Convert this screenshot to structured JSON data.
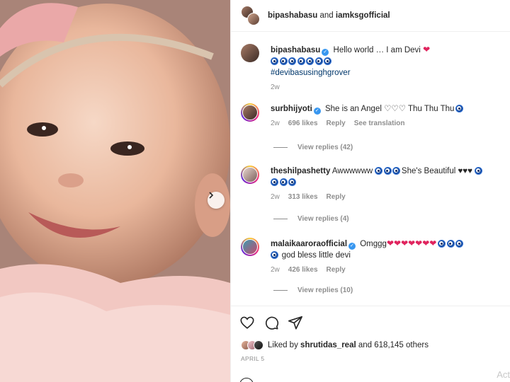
{
  "post": {
    "header": {
      "user1": "bipashabasu",
      "joiner": "and",
      "user2": "iamksgofficial"
    },
    "caption": {
      "username": "bipashabasu",
      "text": "Hello world … I am Devi",
      "hashtag": "#devibasusinghgrover",
      "time": "2w",
      "eye_count": 7
    },
    "comments": [
      {
        "username": "surbhijyoti",
        "text": "She is an Angel ♡♡♡ Thu Thu Thu",
        "time": "2w",
        "likes": "696 likes",
        "reply": "Reply",
        "translate": "See translation",
        "view_replies": "View replies (42)"
      },
      {
        "username": "theshilpashetty",
        "text_a": "Awwwwww",
        "text_b": "She's Beautiful ♥♥♥",
        "time": "2w",
        "likes": "313 likes",
        "reply": "Reply",
        "view_replies": "View replies (4)"
      },
      {
        "username": "malaikaaroraofficial",
        "text_a": "Omggg",
        "text_b": "god bless little devi",
        "time": "2w",
        "likes": "426 likes",
        "reply": "Reply",
        "view_replies": "View replies (10)"
      }
    ],
    "likes": {
      "prefix": "Liked by",
      "user": "shrutidas_real",
      "suffix": "and 618,145 others"
    },
    "date": "APRIL 5",
    "watermark": "Act"
  },
  "colors": {
    "verified": "#3897f0",
    "link": "#00376b",
    "muted": "#8e8e8e",
    "heart": "#e0245e"
  },
  "icons": [
    "heart-icon",
    "comment-icon",
    "share-icon",
    "chevron-right-icon",
    "verified-icon",
    "nazar-eye-icon"
  ]
}
